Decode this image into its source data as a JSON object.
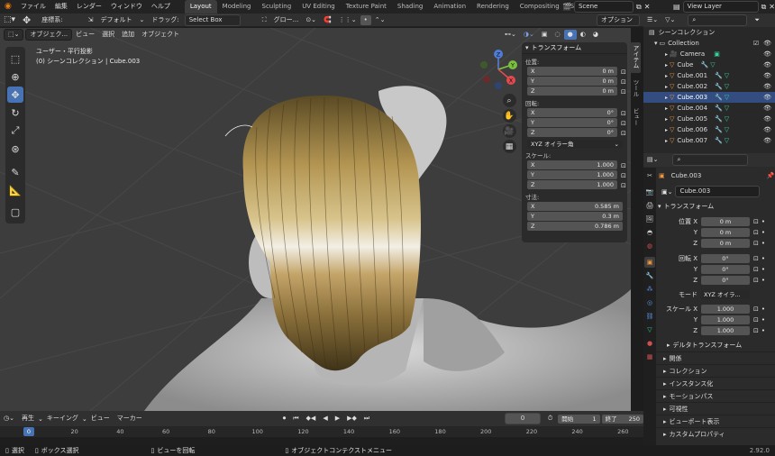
{
  "menus": [
    "ファイル",
    "編集",
    "レンダー",
    "ウィンドウ",
    "ヘルプ"
  ],
  "workspaces": [
    "Layout",
    "Modeling",
    "Sculpting",
    "UV Editing",
    "Texture Paint",
    "Shading",
    "Animation",
    "Rendering",
    "Compositing",
    "Scripting"
  ],
  "scene": "Scene",
  "view_layer": "View Layer",
  "header2": {
    "coord_label": "座標系:",
    "orient_value": "デフォルト",
    "drag_label": "ドラッグ:",
    "drag_value": "Select Box",
    "global_value": "グロー...",
    "options_label": "オプション"
  },
  "viewport_header": {
    "mode": "オブジェク...",
    "view": "ビュー",
    "select": "選択",
    "add": "追加",
    "object": "オブジェクト"
  },
  "viewport_info": {
    "line1": "ユーザー・平行投影",
    "line2": "(0) シーンコレクション | Cube.003"
  },
  "gizmo": {
    "z": "Z",
    "y": "Y",
    "x": "X"
  },
  "npanel": {
    "title": "トランスフォーム",
    "location_label": "位置:",
    "location": [
      {
        "axis": "X",
        "value": "0 m"
      },
      {
        "axis": "Y",
        "value": "0 m"
      },
      {
        "axis": "Z",
        "value": "0 m"
      }
    ],
    "rotation_label": "回転:",
    "rotation": [
      {
        "axis": "X",
        "value": "0°"
      },
      {
        "axis": "Y",
        "value": "0°"
      },
      {
        "axis": "Z",
        "value": "0°"
      }
    ],
    "rotation_mode": "XYZ オイラー角",
    "scale_label": "スケール:",
    "scale": [
      {
        "axis": "X",
        "value": "1.000"
      },
      {
        "axis": "Y",
        "value": "1.000"
      },
      {
        "axis": "Z",
        "value": "1.000"
      }
    ],
    "dims_label": "寸法:",
    "dims": [
      {
        "axis": "X",
        "value": "0.585 m"
      },
      {
        "axis": "Y",
        "value": "0.3 m"
      },
      {
        "axis": "Z",
        "value": "0.786 m"
      }
    ],
    "tabs": [
      "アイテム",
      "ツール",
      "ビュー"
    ]
  },
  "outliner": {
    "root": "シーンコレクション",
    "collection": "Collection",
    "items": [
      "Camera",
      "Cube",
      "Cube.001",
      "Cube.002",
      "Cube.003",
      "Cube.004",
      "Cube.005",
      "Cube.006",
      "Cube.007"
    ]
  },
  "properties": {
    "object_name": "Cube.003",
    "data_name": "Cube.003",
    "transform_title": "トランスフォーム",
    "loc_label": "位置 X",
    "rot_label": "回転 X",
    "scale_label": "スケール X",
    "y_label": "Y",
    "z_label": "Z",
    "loc": [
      "0 m",
      "0 m",
      "0 m"
    ],
    "rot": [
      "0°",
      "0°",
      "0°"
    ],
    "scale": [
      "1.000",
      "1.000",
      "1.000"
    ],
    "mode_label": "モード",
    "mode_value": "XYZ オイラ...",
    "delta": "デルタトランスフォーム",
    "sections": [
      "関係",
      "コレクション",
      "インスタンス化",
      "モーションパス",
      "可視性",
      "ビューポート表示",
      "カスタムプロパティ"
    ]
  },
  "timeline": {
    "playback": "再生",
    "keying": "キーイング",
    "view": "ビュー",
    "marker": "マーカー",
    "current_frame": "0",
    "start_label": "開始",
    "start": "1",
    "end_label": "終了",
    "end": "250",
    "ruler": [
      "0",
      "20",
      "40",
      "60",
      "80",
      "100",
      "120",
      "140",
      "160",
      "180",
      "200",
      "220",
      "240",
      "260"
    ]
  },
  "status": {
    "select": "選択",
    "box_select": "ボックス選択",
    "rotate_view": "ビューを回転",
    "context_menu": "オブジェクトコンテクストメニュー",
    "version": "2.92.0"
  },
  "colors": {
    "accent": "#4772b3",
    "object_orange": "#f1973c",
    "mesh_green": "#34d3a0",
    "selected_highlight": "#334d80"
  }
}
